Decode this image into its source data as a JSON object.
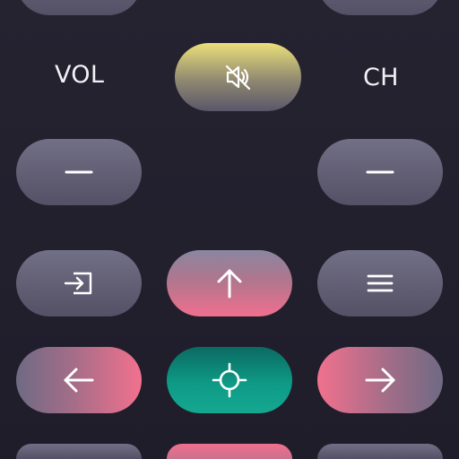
{
  "labels": {
    "volume": "VOL",
    "channel": "CH"
  },
  "icons": {
    "mute": "speaker-muted-icon",
    "vol_down": "minus-icon",
    "ch_down": "minus-icon",
    "input": "input-source-icon",
    "up": "arrow-up-icon",
    "menu": "menu-lines-icon",
    "left": "arrow-left-icon",
    "ok": "crosshair-icon",
    "right": "arrow-right-icon"
  },
  "colors": {
    "background": "#252330",
    "button_gray": "#6a677c",
    "mute_yellow": "#ebe07a",
    "nav_pink": "#f06f8e",
    "ok_teal": "#0e9a86",
    "foreground": "#ffffff"
  }
}
